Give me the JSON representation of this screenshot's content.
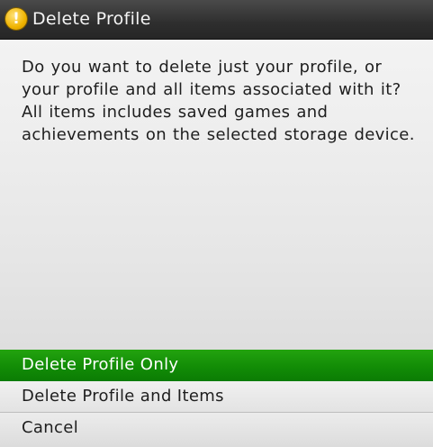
{
  "dialog": {
    "title": "Delete Profile",
    "icon": "warning-icon",
    "accent_color": "#128c06",
    "message": "Do you want to delete just your profile, or your profile and all items associated with it? All items includes saved games and achievements on the selected storage device.",
    "options": [
      {
        "label": "Delete Profile Only",
        "selected": true
      },
      {
        "label": "Delete Profile and Items",
        "selected": false
      },
      {
        "label": "Cancel",
        "selected": false
      }
    ]
  }
}
